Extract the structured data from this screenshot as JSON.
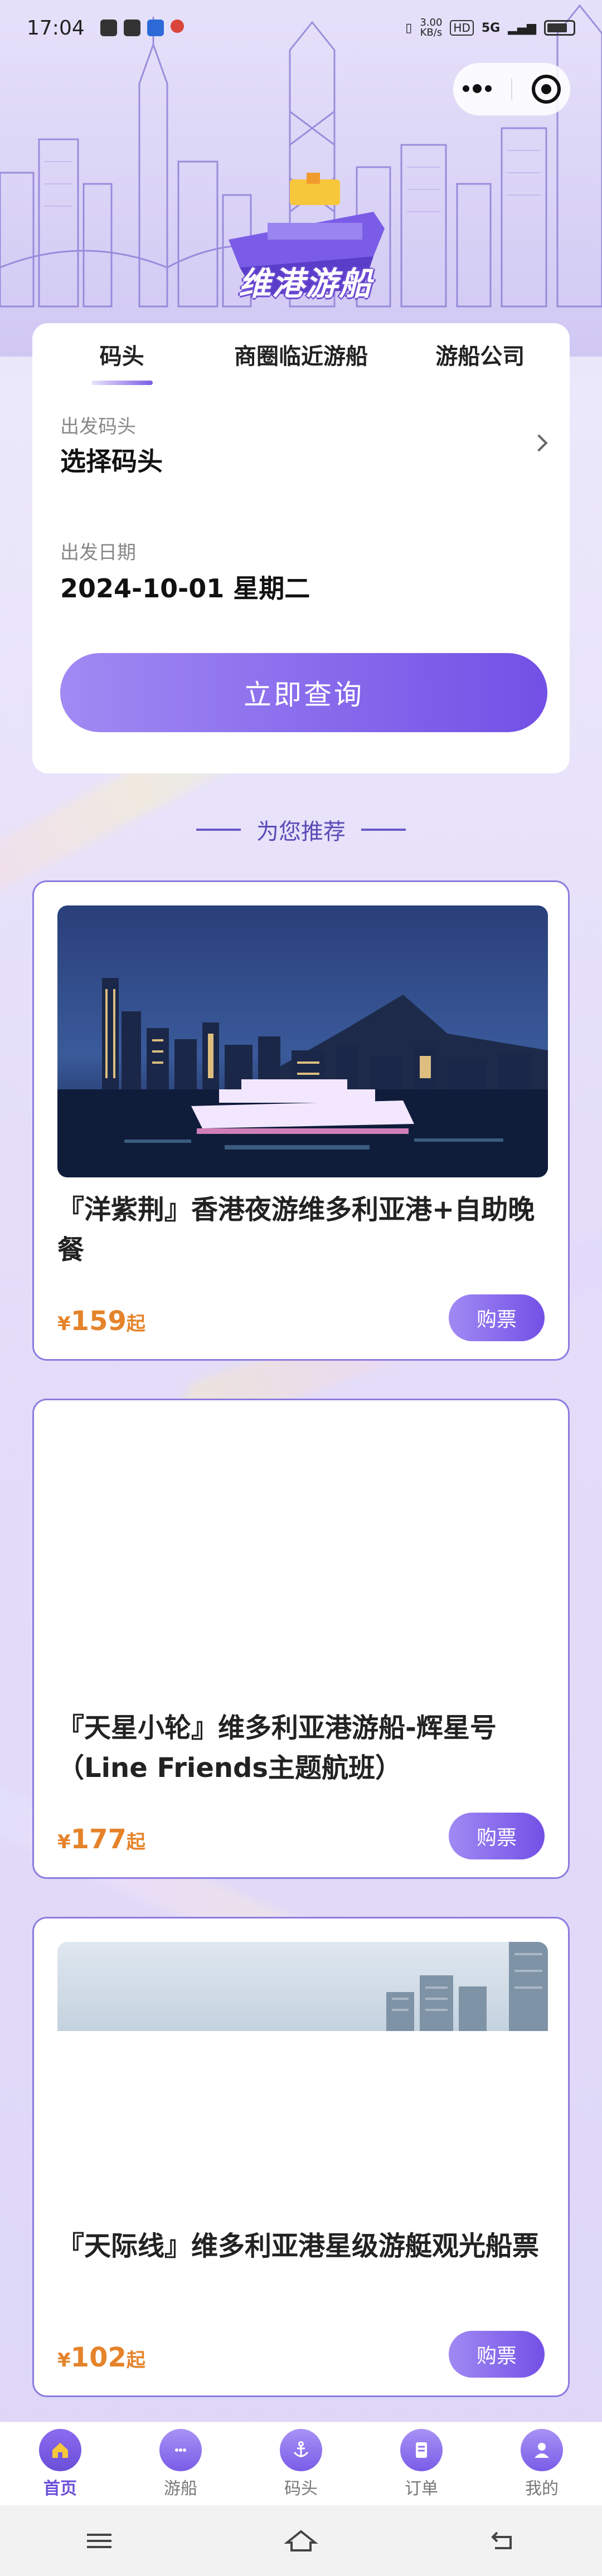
{
  "status_bar": {
    "time": "17:04",
    "net_speed_value": "3.00",
    "net_speed_unit": "KB/s",
    "hd_badge": "HD",
    "signal_badge": "5G"
  },
  "header": {
    "logo_text": "维港游船"
  },
  "search": {
    "tabs": [
      {
        "label": "码头",
        "active": true
      },
      {
        "label": "商圈临近游船",
        "active": false
      },
      {
        "label": "游船公司",
        "active": false
      }
    ],
    "departure_pier_label": "出发码头",
    "departure_pier_value": "选择码头",
    "date_label": "出发日期",
    "date_value": "2024-10-01 星期二",
    "query_button": "立即查询"
  },
  "recommend": {
    "title": "为您推荐"
  },
  "products": [
    {
      "title": "『洋紫荆』香港夜游维多利亚港+自助晚餐",
      "currency": "¥",
      "price": "159",
      "suffix": "起",
      "buy_label": "购票",
      "image": "night-harbor-cruise"
    },
    {
      "title": "『天星小轮』维多利亚港游船-辉星号（Line Friends主题航班）",
      "currency": "¥",
      "price": "177",
      "suffix": "起",
      "buy_label": "购票",
      "image": "blank"
    },
    {
      "title": "『天际线』维多利亚港星级游艇观光船票",
      "currency": "¥",
      "price": "102",
      "suffix": "起",
      "buy_label": "购票",
      "image": "skyline-partial"
    }
  ],
  "tabbar": [
    {
      "label": "首页",
      "icon": "home-icon",
      "active": true
    },
    {
      "label": "游船",
      "icon": "cruise-icon",
      "active": false
    },
    {
      "label": "码头",
      "icon": "anchor-icon",
      "active": false
    },
    {
      "label": "订单",
      "icon": "order-icon",
      "active": false
    },
    {
      "label": "我的",
      "icon": "user-icon",
      "active": false
    }
  ],
  "colors": {
    "accent": "#7350e6",
    "price": "#e5832a",
    "card_border": "#8d7be0"
  }
}
